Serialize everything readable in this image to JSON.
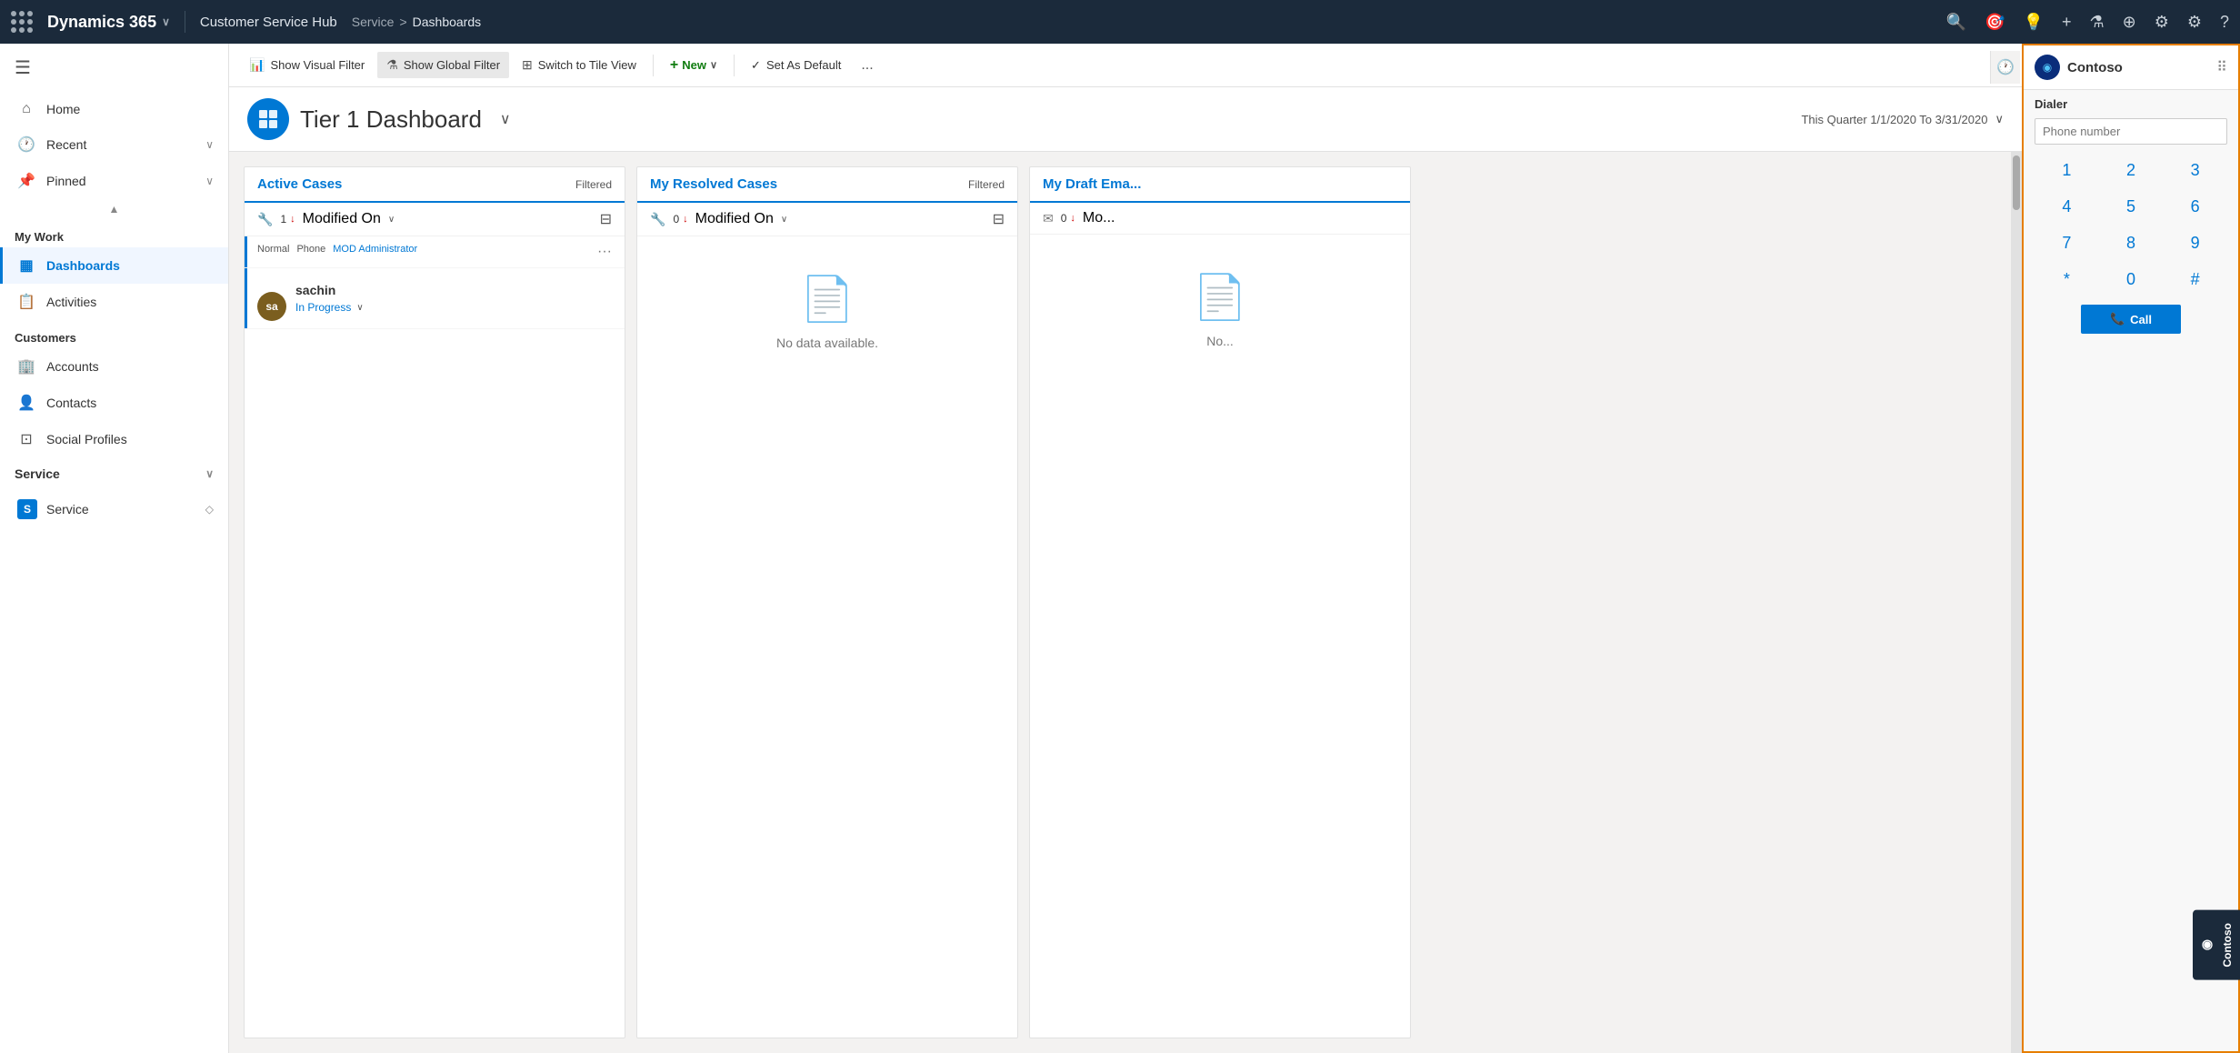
{
  "topnav": {
    "app_name": "Dynamics 365",
    "app_hub": "Customer Service Hub",
    "breadcrumb_parent": "Service",
    "breadcrumb_separator": ">",
    "breadcrumb_current": "Dashboards"
  },
  "toolbar": {
    "show_visual_filter": "Show Visual Filter",
    "show_global_filter": "Show Global Filter",
    "switch_to_tile_view": "Switch to Tile View",
    "new_label": "New",
    "set_as_default": "Set As Default",
    "more": "..."
  },
  "dashboard": {
    "title": "Tier 1 Dashboard",
    "date_range": "This Quarter 1/1/2020 To 3/31/2020"
  },
  "cards": [
    {
      "id": "active-cases",
      "title": "Active Cases",
      "filtered": "Filtered",
      "count": "1",
      "sort_label": "Modified On",
      "rows": [
        {
          "type": "Normal",
          "channel": "Phone",
          "owner": "MOD Administrator",
          "avatar_initials": "sa",
          "name": "sachin",
          "status": "In Progress"
        }
      ]
    },
    {
      "id": "my-resolved-cases",
      "title": "My Resolved Cases",
      "filtered": "Filtered",
      "count": "0",
      "sort_label": "Modified On",
      "no_data": "No data available."
    },
    {
      "id": "my-draft-emails",
      "title": "My Draft Ema...",
      "filtered": "",
      "count": "0",
      "sort_label": "Mo...",
      "no_data": "No..."
    }
  ],
  "sidebar": {
    "nav_items": [
      {
        "id": "home",
        "label": "Home",
        "icon": "⌂"
      },
      {
        "id": "recent",
        "label": "Recent",
        "icon": "🕐",
        "has_chevron": true
      },
      {
        "id": "pinned",
        "label": "Pinned",
        "icon": "📌",
        "has_chevron": true
      }
    ],
    "my_work_label": "My Work",
    "my_work_items": [
      {
        "id": "dashboards",
        "label": "Dashboards",
        "icon": "▦",
        "active": true
      },
      {
        "id": "activities",
        "label": "Activities",
        "icon": "📋",
        "active": false
      }
    ],
    "customers_label": "Customers",
    "customers_items": [
      {
        "id": "accounts",
        "label": "Accounts",
        "icon": "🏢"
      },
      {
        "id": "contacts",
        "label": "Contacts",
        "icon": "👤"
      },
      {
        "id": "social_profiles",
        "label": "Social Profiles",
        "icon": "🔲"
      }
    ],
    "service_label": "Service",
    "service_items": [
      {
        "id": "service",
        "label": "Service",
        "avatar": "S"
      }
    ]
  },
  "dialer": {
    "company": "Contoso",
    "title": "Dialer",
    "phone_placeholder": "Phone number",
    "keys": [
      "1",
      "2",
      "3",
      "4",
      "5",
      "6",
      "7",
      "8",
      "9",
      "*",
      "0",
      "#"
    ],
    "call_button": "Call"
  }
}
